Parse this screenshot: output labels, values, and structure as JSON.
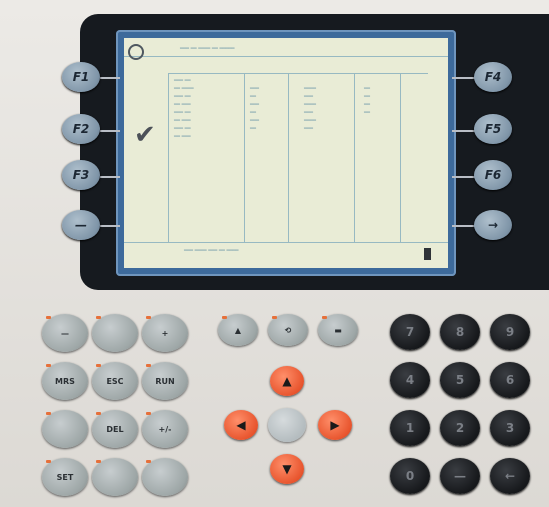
{
  "fkeys_left": [
    "F1",
    "F2",
    "F3",
    "—"
  ],
  "fkeys_right": [
    "F4",
    "F5",
    "F6",
    "→"
  ],
  "gray_keys": [
    [
      "—",
      "",
      "+"
    ],
    [
      "MRS",
      "ESC",
      "RUN"
    ],
    [
      "",
      "DEL",
      "+/-"
    ],
    [
      "SET",
      "",
      ""
    ]
  ],
  "top_keys": [
    "▲",
    "⟲",
    "▬"
  ],
  "arrows": {
    "up": "▲",
    "left": "◀",
    "right": "▶",
    "down": "▼"
  },
  "numpad": [
    [
      "7",
      "8",
      "9"
    ],
    [
      "4",
      "5",
      "6"
    ],
    [
      "1",
      "2",
      "3"
    ],
    [
      "0",
      "—",
      "←"
    ]
  ],
  "screen": {
    "check_mark": "✔"
  },
  "colors": {
    "accent": "#e8552e",
    "screen": "#e9ecd6",
    "bezel": "#161a1f"
  }
}
